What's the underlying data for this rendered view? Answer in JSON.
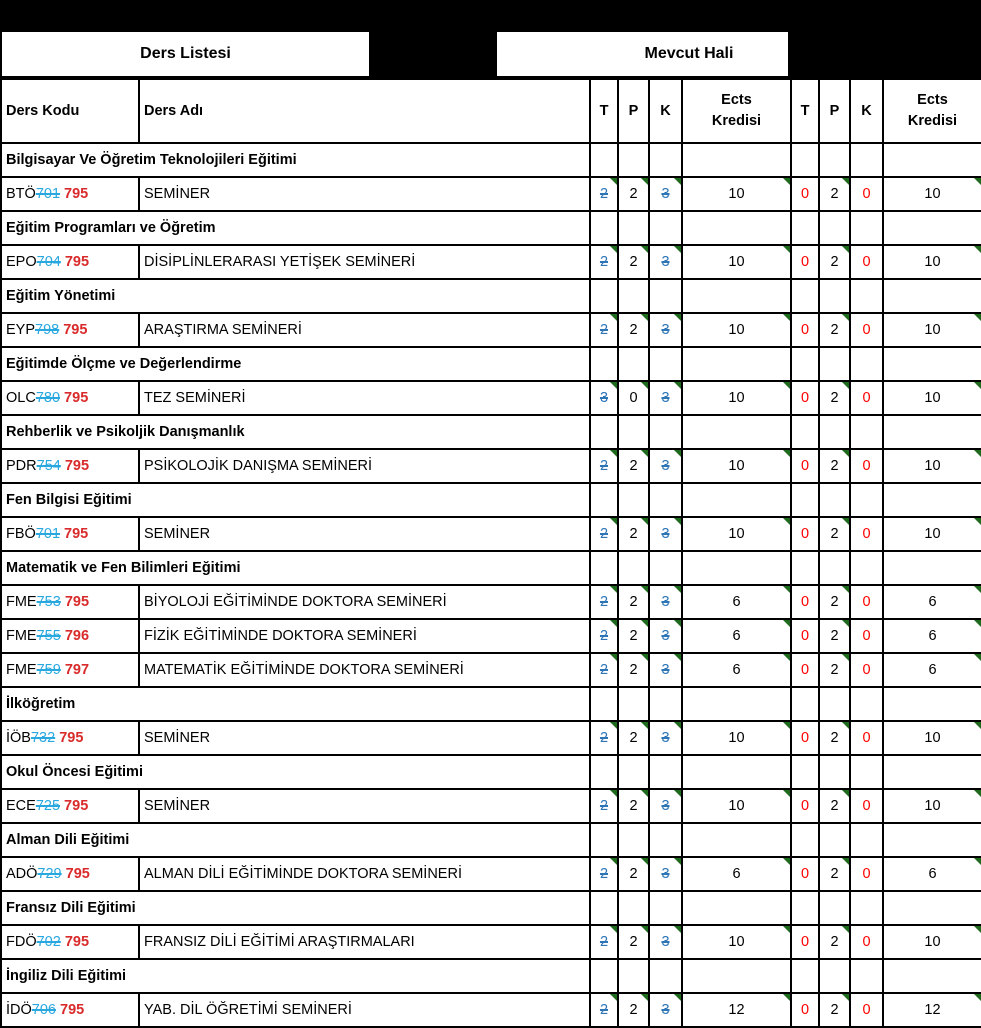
{
  "document": {
    "top_banner_color": "#000000",
    "accent_section_color": "#0000CC",
    "old_code_color": "#29A8DF",
    "new_code_color": "#D92B2B",
    "struck_value_color": "#2E75B6",
    "new_value_color": "#FF0000",
    "comment_marker_color": "#1E6B1E"
  },
  "banners": {
    "ders_listesi": "Ders Listesi",
    "gap": "",
    "mevcut_hali": "Mevcut Hali"
  },
  "columns": {
    "ders_kodu": "Ders Kodu",
    "ders_adi": "Ders Adı",
    "t1": "T",
    "p1": "P",
    "k1": "K",
    "ects1_line1": "Ects",
    "ects1_line2": "Kredisi",
    "t2": "T",
    "p2": "P",
    "k2": "K",
    "ects2_line1": "Ects",
    "ects2_line2": "Kredisi"
  },
  "rows": [
    {
      "kind": "section",
      "label": "Bilgisayar Ve Öğretim Teknolojileri Eğitimi"
    },
    {
      "kind": "data",
      "prefix": "BTÖ",
      "old_code": "701",
      "new_code": "795",
      "name": "SEMİNER",
      "t_old": "2",
      "p_old": "2",
      "k_old": "3",
      "ects_old": "10",
      "t_new": "0",
      "p_new": "2",
      "k_new": "0",
      "ects_new": "10"
    },
    {
      "kind": "section",
      "label": "Eğitim Programları ve Öğretim"
    },
    {
      "kind": "data",
      "prefix": "EPO",
      "old_code": "704",
      "new_code": "795",
      "name": "DİSİPLİNLERARASI YETİŞEK SEMİNERİ",
      "t_old": "2",
      "p_old": "2",
      "k_old": "3",
      "ects_old": "10",
      "t_new": "0",
      "p_new": "2",
      "k_new": "0",
      "ects_new": "10"
    },
    {
      "kind": "section",
      "label": "Eğitim Yönetimi"
    },
    {
      "kind": "data",
      "prefix": "EYP",
      "old_code": "798",
      "new_code": "795",
      "name": "ARAŞTIRMA SEMİNERİ",
      "t_old": "2",
      "p_old": "2",
      "k_old": "3",
      "ects_old": "10",
      "t_new": "0",
      "p_new": "2",
      "k_new": "0",
      "ects_new": "10"
    },
    {
      "kind": "section",
      "label": "Eğitimde Ölçme ve Değerlendirme"
    },
    {
      "kind": "data",
      "prefix": "OLC",
      "old_code": "780",
      "new_code": "795",
      "name": "TEZ SEMİNERİ",
      "t_old": "3",
      "p_old": "0",
      "k_old": "3",
      "ects_old": "10",
      "t_new": "0",
      "p_new": "2",
      "k_new": "0",
      "ects_new": "10"
    },
    {
      "kind": "section",
      "label": "Rehberlik ve Psikoljik Danışmanlık"
    },
    {
      "kind": "data",
      "prefix": "PDR",
      "old_code": "754",
      "new_code": "795",
      "name": "PSİKOLOJİK DANIŞMA SEMİNERİ",
      "t_old": "2",
      "p_old": "2",
      "k_old": "3",
      "ects_old": "10",
      "t_new": "0",
      "p_new": "2",
      "k_new": "0",
      "ects_new": "10"
    },
    {
      "kind": "section",
      "label": "Fen Bilgisi Eğitimi"
    },
    {
      "kind": "data",
      "prefix": "FBÖ",
      "old_code": "701",
      "new_code": "795",
      "name": "SEMİNER",
      "t_old": "2",
      "p_old": "2",
      "k_old": "3",
      "ects_old": "10",
      "t_new": "0",
      "p_new": "2",
      "k_new": "0",
      "ects_new": "10"
    },
    {
      "kind": "section",
      "label": "Matematik ve Fen Bilimleri Eğitimi"
    },
    {
      "kind": "data",
      "prefix": "FME",
      "old_code": "753",
      "new_code": "795",
      "name": "BİYOLOJİ EĞİTİMİNDE DOKTORA SEMİNERİ",
      "t_old": "2",
      "p_old": "2",
      "k_old": "3",
      "ects_old": "6",
      "t_new": "0",
      "p_new": "2",
      "k_new": "0",
      "ects_new": "6"
    },
    {
      "kind": "data",
      "prefix": "FME",
      "old_code": "755",
      "new_code": "796",
      "name": "FİZİK EĞİTİMİNDE DOKTORA SEMİNERİ",
      "t_old": "2",
      "p_old": "2",
      "k_old": "3",
      "ects_old": "6",
      "t_new": "0",
      "p_new": "2",
      "k_new": "0",
      "ects_new": "6"
    },
    {
      "kind": "data",
      "prefix": "FME",
      "old_code": "759",
      "new_code": "797",
      "name": "MATEMATİK EĞİTİMİNDE DOKTORA SEMİNERİ",
      "t_old": "2",
      "p_old": "2",
      "k_old": "3",
      "ects_old": "6",
      "t_new": "0",
      "p_new": "2",
      "k_new": "0",
      "ects_new": "6"
    },
    {
      "kind": "section",
      "label": "İlköğretim"
    },
    {
      "kind": "data",
      "prefix": "İÖB",
      "old_code": "732",
      "new_code": "795",
      "name": "SEMİNER",
      "t_old": "2",
      "p_old": "2",
      "k_old": "3",
      "ects_old": "10",
      "t_new": "0",
      "p_new": "2",
      "k_new": "0",
      "ects_new": "10"
    },
    {
      "kind": "section",
      "label": "Okul Öncesi Eğitimi"
    },
    {
      "kind": "data",
      "prefix": "ECE",
      "old_code": "725",
      "new_code": "795",
      "name": "SEMİNER",
      "t_old": "2",
      "p_old": "2",
      "k_old": "3",
      "ects_old": "10",
      "t_new": "0",
      "p_new": "2",
      "k_new": "0",
      "ects_new": "10"
    },
    {
      "kind": "section",
      "label": "Alman Dili Eğitimi"
    },
    {
      "kind": "data",
      "prefix": "ADÖ",
      "old_code": "729",
      "new_code": "795",
      "name": "ALMAN DİLİ EĞİTİMİNDE DOKTORA SEMİNERİ",
      "t_old": "2",
      "p_old": "2",
      "k_old": "3",
      "ects_old": "6",
      "t_new": "0",
      "p_new": "2",
      "k_new": "0",
      "ects_new": "6"
    },
    {
      "kind": "section",
      "label": "Fransız Dili Eğitimi"
    },
    {
      "kind": "data",
      "prefix": "FDÖ",
      "old_code": "702",
      "new_code": "795",
      "name": "FRANSIZ DİLİ EĞİTİMİ ARAŞTIRMALARI",
      "t_old": "2",
      "p_old": "2",
      "k_old": "3",
      "ects_old": "10",
      "t_new": "0",
      "p_new": "2",
      "k_new": "0",
      "ects_new": "10"
    },
    {
      "kind": "section",
      "label": "İngiliz Dili Eğitimi"
    },
    {
      "kind": "data",
      "prefix": "İDÖ",
      "old_code": "706",
      "new_code": "795",
      "name": "YAB. DİL ÖĞRETİMİ SEMİNERİ",
      "t_old": "2",
      "p_old": "2",
      "k_old": "3",
      "ects_old": "12",
      "t_new": "0",
      "p_new": "2",
      "k_new": "0",
      "ects_new": "12"
    }
  ]
}
